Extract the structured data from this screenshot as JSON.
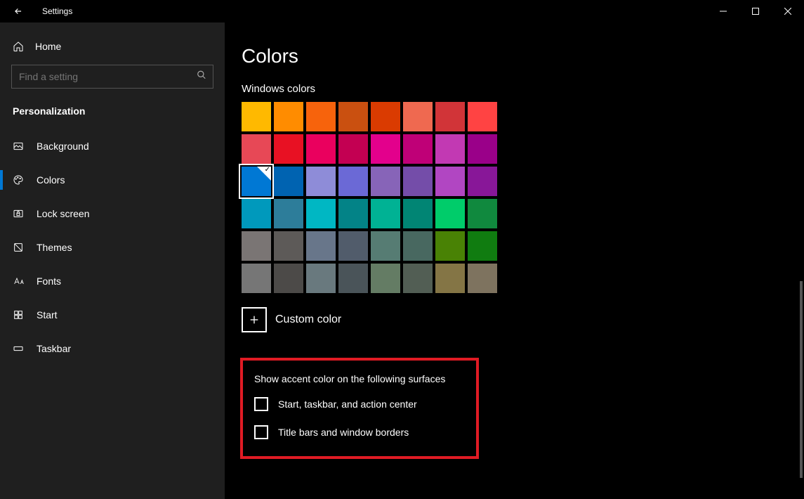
{
  "app_title": "Settings",
  "home_label": "Home",
  "search": {
    "placeholder": "Find a setting"
  },
  "section_title": "Personalization",
  "nav": [
    {
      "id": "background",
      "label": "Background"
    },
    {
      "id": "colors",
      "label": "Colors",
      "active": true
    },
    {
      "id": "lockscreen",
      "label": "Lock screen"
    },
    {
      "id": "themes",
      "label": "Themes"
    },
    {
      "id": "fonts",
      "label": "Fonts"
    },
    {
      "id": "start",
      "label": "Start"
    },
    {
      "id": "taskbar",
      "label": "Taskbar"
    }
  ],
  "page_title": "Colors",
  "windows_colors_label": "Windows colors",
  "color_grid": [
    [
      "#ffb900",
      "#ff8c00",
      "#f7630c",
      "#ca5010",
      "#da3b01",
      "#ef6950",
      "#d13438",
      "#ff4343"
    ],
    [
      "#e74856",
      "#e81123",
      "#ea005e",
      "#c30052",
      "#e3008c",
      "#bf0077",
      "#c239b3",
      "#9a0089"
    ],
    [
      "#0078d4",
      "#0063b1",
      "#8e8cd8",
      "#6b69d6",
      "#8764b8",
      "#744da9",
      "#b146c2",
      "#881798"
    ],
    [
      "#0099bc",
      "#2d7d9a",
      "#00b7c3",
      "#038387",
      "#00b294",
      "#018574",
      "#00cc6a",
      "#10893e"
    ],
    [
      "#7a7574",
      "#5d5a58",
      "#68768a",
      "#515c6b",
      "#567c73",
      "#486860",
      "#498205",
      "#107c10"
    ],
    [
      "#767676",
      "#4c4a48",
      "#69797e",
      "#4a5459",
      "#647c64",
      "#525e54",
      "#847545",
      "#7e735f"
    ]
  ],
  "selected_color": {
    "row": 2,
    "col": 0
  },
  "custom_color_label": "Custom color",
  "surfaces": {
    "title": "Show accent color on the following surfaces",
    "option1": "Start, taskbar, and action center",
    "option2": "Title bars and window borders"
  }
}
